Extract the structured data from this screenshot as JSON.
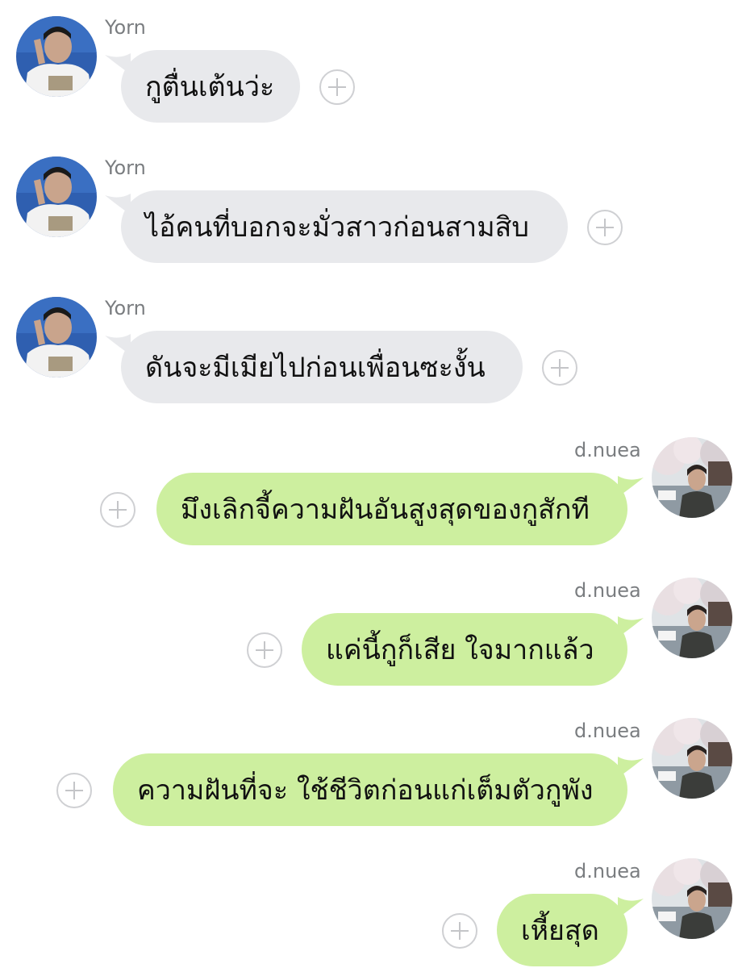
{
  "users": {
    "left": {
      "name": "Yorn"
    },
    "right": {
      "name": "d.nuea"
    }
  },
  "messages": [
    {
      "sender": "Yorn",
      "text": "กูตื่นเต้นว่ะ"
    },
    {
      "sender": "Yorn",
      "text": "ไอ้คนที่บอกจะมั่วสาวก่อนสามสิบ"
    },
    {
      "sender": "Yorn",
      "text": "ดันจะมีเมียไปก่อนเพื่อนซะงั้น"
    },
    {
      "sender": "d.nuea",
      "text": "มึงเลิกจี้ความฝันอันสูงสุดของกูสักที"
    },
    {
      "sender": "d.nuea",
      "text": "แค่นี้กูก็เสีย ใจมากแล้ว"
    },
    {
      "sender": "d.nuea",
      "text": "ความฝันที่จะ ใช้ชีวิตก่อนแก่เต็มตัวกูพัง"
    },
    {
      "sender": "d.nuea",
      "text": "เหี้ยสุด"
    }
  ],
  "colors": {
    "incoming_bubble": "#e8e9ec",
    "outgoing_bubble": "#cdef9f",
    "name_text": "#7a7d80",
    "plus_icon": "#c4c5c8"
  },
  "icons": {
    "add_reaction": "plus-circle-icon"
  }
}
